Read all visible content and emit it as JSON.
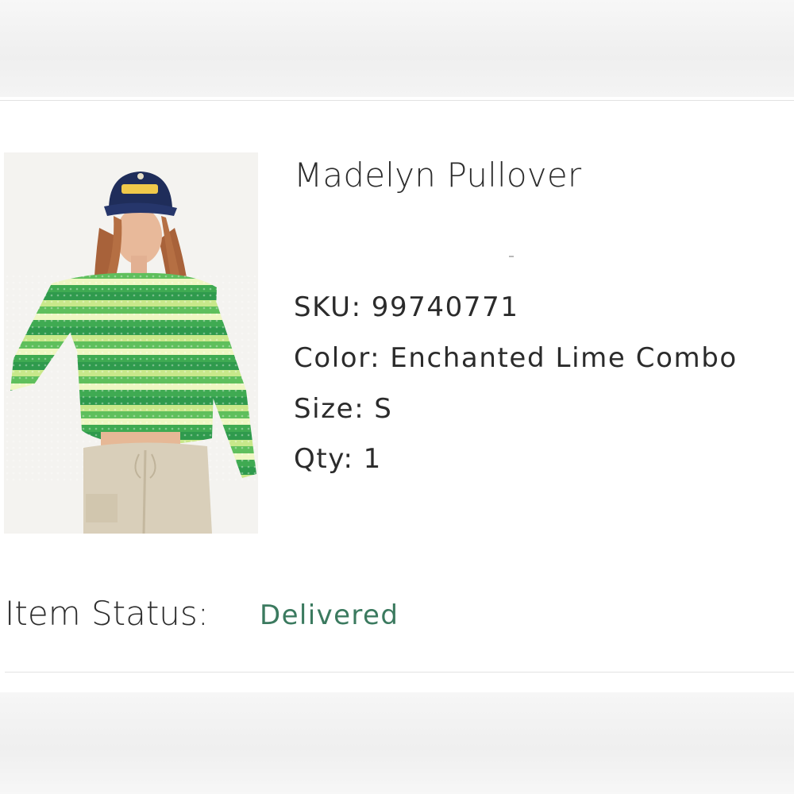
{
  "product": {
    "name": "Madelyn Pullover",
    "image_alt": "Madelyn Pullover",
    "details": [
      {
        "label": "SKU:",
        "value": "99740771"
      },
      {
        "label": "Color:",
        "value": "Enchanted Lime Combo"
      },
      {
        "label": "Size:",
        "value": "S"
      },
      {
        "label": "Qty:",
        "value": "1"
      }
    ]
  },
  "status": {
    "label": "Item Status:",
    "value": "Delivered"
  },
  "colors": {
    "status_text": "#3b7a5f",
    "primary_text": "#2d2d2d",
    "divider": "#e2e2e2"
  },
  "icons": {
    "product_photo": "green-striped-crochet-pullover-photo"
  }
}
